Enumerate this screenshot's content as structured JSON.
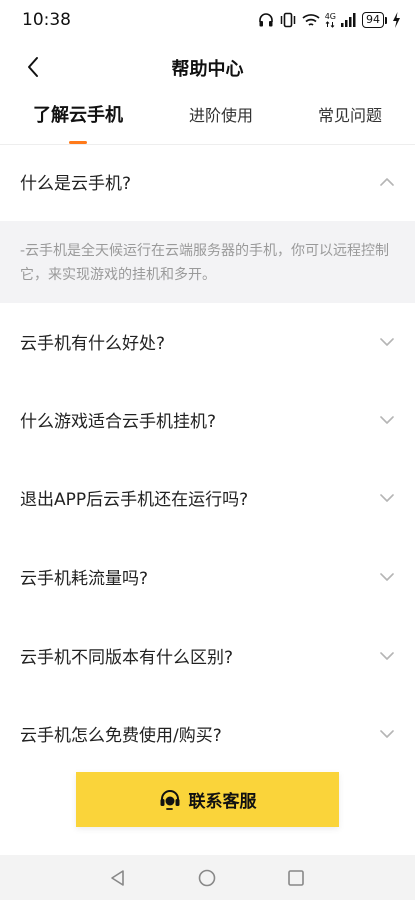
{
  "status": {
    "time": "10:38",
    "network": "4G",
    "battery": "94"
  },
  "header": {
    "title": "帮助中心"
  },
  "tabs": [
    {
      "label": "了解云手机",
      "active": true
    },
    {
      "label": "进阶使用",
      "active": false
    },
    {
      "label": "常见问题",
      "active": false
    }
  ],
  "faq": {
    "items": [
      {
        "question": "什么是云手机?",
        "expanded": true,
        "answer": "-云手机是全天候运行在云端服务器的手机，你可以远程控制它，来实现游戏的挂机和多开。"
      },
      {
        "question": "云手机有什么好处?",
        "expanded": false
      },
      {
        "question": "什么游戏适合云手机挂机?",
        "expanded": false
      },
      {
        "question": "退出APP后云手机还在运行吗?",
        "expanded": false
      },
      {
        "question": "云手机耗流量吗?",
        "expanded": false
      },
      {
        "question": "云手机不同版本有什么区别?",
        "expanded": false
      },
      {
        "question": "云手机怎么免费使用/购买?",
        "expanded": false
      }
    ]
  },
  "contact": {
    "label": "联系客服"
  },
  "colors": {
    "accent": "#ff7a1a",
    "button": "#fad43a",
    "answer_bg": "#f3f3f5"
  }
}
